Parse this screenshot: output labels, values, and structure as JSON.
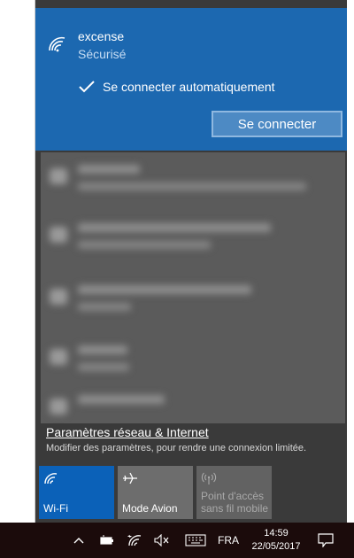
{
  "selected_network": {
    "name": "excense",
    "status": "Sécurisé",
    "auto_connect_label": "Se connecter automatiquement",
    "auto_connect_checked": true,
    "connect_button": "Se connecter"
  },
  "settings": {
    "link_label": "Paramètres réseau & Internet",
    "description": "Modifier des paramètres, pour rendre une connexion limitée."
  },
  "quick_actions": [
    {
      "label": "Wi-Fi",
      "icon": "wifi-icon",
      "active": true
    },
    {
      "label": "Mode Avion",
      "icon": "airplane-icon",
      "active": false
    },
    {
      "label": "Point d'accès sans fil mobile",
      "icon": "hotspot-icon",
      "active": false,
      "disabled": true
    }
  ],
  "taskbar": {
    "language": "FRA",
    "time": "14:59",
    "date": "22/05/2017",
    "icons": [
      "chevron-up-icon",
      "battery-icon",
      "wifi-icon",
      "volume-muted-icon",
      "keyboard-icon",
      "notification-icon"
    ]
  },
  "colors": {
    "accent": "#1c68b0",
    "flyout_bg": "#3a3a3a",
    "tile_active": "#0b61b8",
    "taskbar_bg": "#1b0b0b"
  }
}
